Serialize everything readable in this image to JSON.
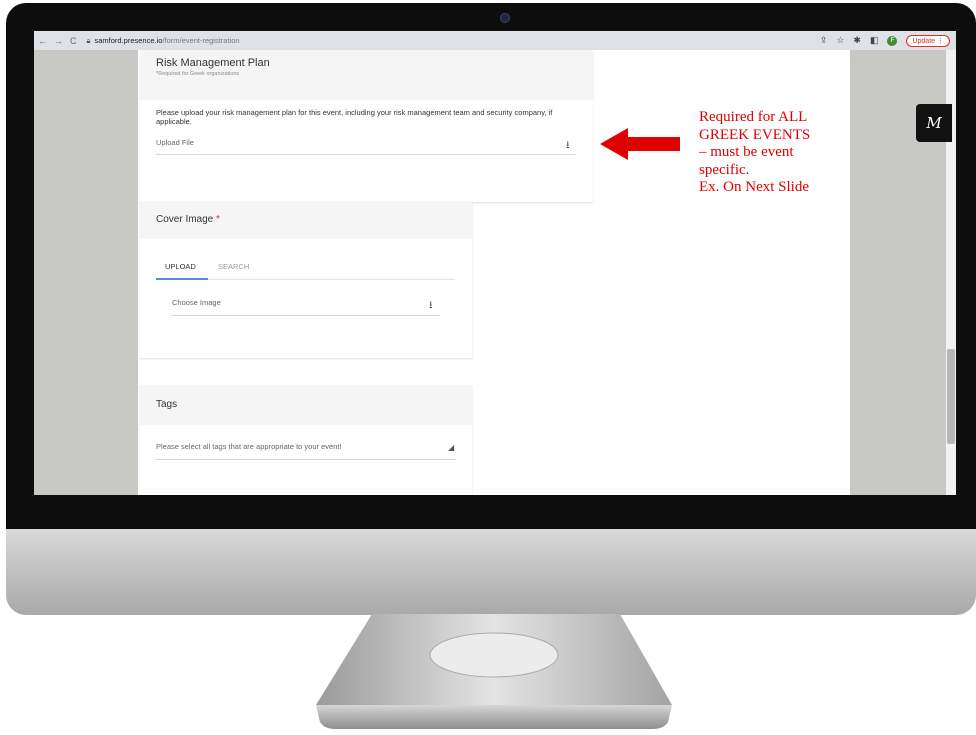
{
  "browser": {
    "url_host": "samford.presence.io",
    "url_path": "/form/event-registration",
    "update_label": "Update",
    "profile_initial": "F"
  },
  "risk_plan": {
    "title": "Risk Management Plan",
    "subtitle": "*Required for Greek organizations",
    "description": "Please upload your risk management plan for this event, including your risk management team and security company, if applicable.",
    "upload_placeholder": "Upload File"
  },
  "cover_image": {
    "title": "Cover Image",
    "required_mark": "*",
    "tabs": [
      "UPLOAD",
      "SEARCH"
    ],
    "choose_placeholder": "Choose Image"
  },
  "tags": {
    "title": "Tags",
    "placeholder": "Please select all tags that are appropriate to your event!"
  },
  "annotation": {
    "lines": [
      "Required for ALL",
      "GREEK EVENTS",
      "– must be event",
      "specific.",
      "Ex. On Next Slide"
    ],
    "color": "#e00000"
  },
  "widget_badge": "M"
}
